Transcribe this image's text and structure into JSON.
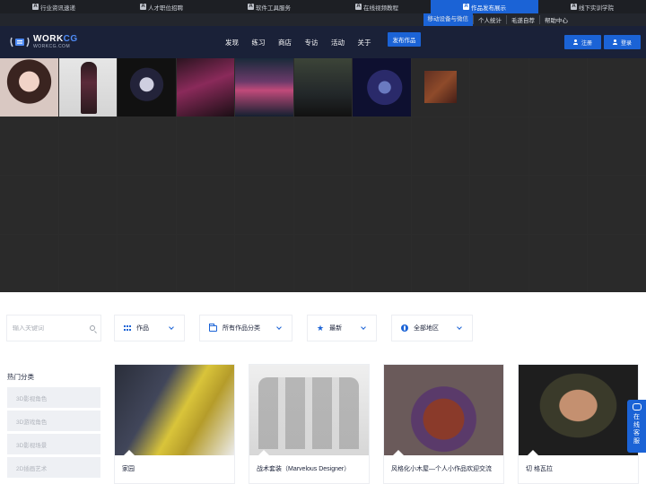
{
  "topbar": {
    "items": [
      {
        "label": "行业资讯速递",
        "active": false
      },
      {
        "label": "人才职位招聘",
        "active": false
      },
      {
        "label": "软件工具服务",
        "active": false
      },
      {
        "label": "在线视频教程",
        "active": false
      },
      {
        "label": "作品发布展示",
        "active": true
      },
      {
        "label": "线下实训学院",
        "active": false
      }
    ],
    "icon_letter": "A"
  },
  "subbar": {
    "items": [
      "移动设备与微信",
      "个人统计",
      "毛遂自荐",
      "帮助中心"
    ]
  },
  "header": {
    "logo_main": "WORK",
    "logo_accent": "CG",
    "logo_sub": "WORKCG.COM",
    "nav": [
      "发现",
      "练习",
      "商店",
      "专访",
      "活动",
      "关于"
    ],
    "publish_label": "发布作品",
    "register_label": "注册",
    "login_label": "登录"
  },
  "filters": {
    "search_placeholder": "输入关键词",
    "type_label": "作品",
    "category_label": "所有作品分类",
    "sort_label": "最新",
    "region_label": "全部地区"
  },
  "sidebar": {
    "title": "热门分类",
    "items": [
      "3D影视角色",
      "3D游戏角色",
      "3D影视场景",
      "2D插画艺术"
    ]
  },
  "cards": [
    {
      "title": "家园"
    },
    {
      "title": "战术套装（Marvelous Designer）"
    },
    {
      "title": "风格化小木屋—个人小作品欢迎交流"
    },
    {
      "title": "切 格瓦拉"
    }
  ],
  "float_widget": {
    "line1": "在",
    "line2": "线",
    "line3": "客",
    "line4": "服"
  },
  "colors": {
    "accent": "#1b63d6",
    "header_bg": "#1a2138"
  }
}
